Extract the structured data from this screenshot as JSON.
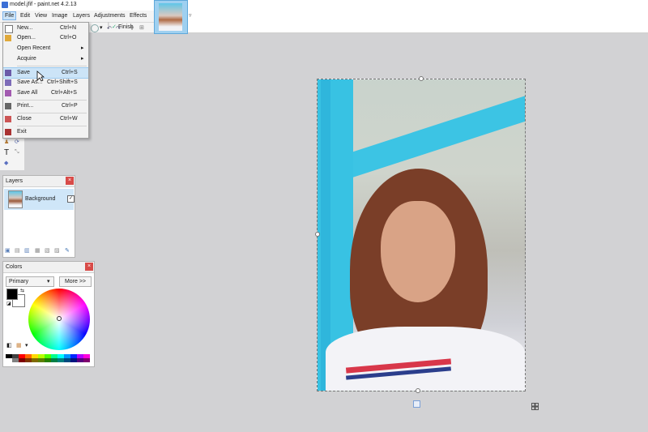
{
  "window": {
    "title": "model.jfif - paint.net 4.2.13"
  },
  "menubar": {
    "items": [
      "File",
      "Edit",
      "View",
      "Image",
      "Layers",
      "Adjustments",
      "Effects"
    ]
  },
  "toolbar": {
    "finish_label": "Finish"
  },
  "file_menu": {
    "items": [
      {
        "label": "New...",
        "shortcut": "Ctrl+N"
      },
      {
        "label": "Open...",
        "shortcut": "Ctrl+O"
      },
      {
        "label": "Open Recent",
        "shortcut": ""
      },
      {
        "label": "Acquire",
        "shortcut": ""
      },
      {
        "label": "Save",
        "shortcut": "Ctrl+S"
      },
      {
        "label": "Save As...",
        "shortcut": "Ctrl+Shift+S"
      },
      {
        "label": "Save All",
        "shortcut": "Ctrl+Alt+S"
      },
      {
        "label": "Print...",
        "shortcut": "Ctrl+P"
      },
      {
        "label": "Close",
        "shortcut": "Ctrl+W"
      },
      {
        "label": "Exit",
        "shortcut": ""
      }
    ]
  },
  "layers_panel": {
    "title": "Layers",
    "layer": {
      "name": "Background",
      "visible": true
    }
  },
  "colors_panel": {
    "title": "Colors",
    "mode_select": "Primary",
    "more_button": "More >>",
    "primary_color": "#000000",
    "secondary_color": "#ffffff"
  },
  "colors": {
    "accent": "#cce4f7",
    "close_red": "#d84b48",
    "post_blue": "#38c2e3"
  }
}
